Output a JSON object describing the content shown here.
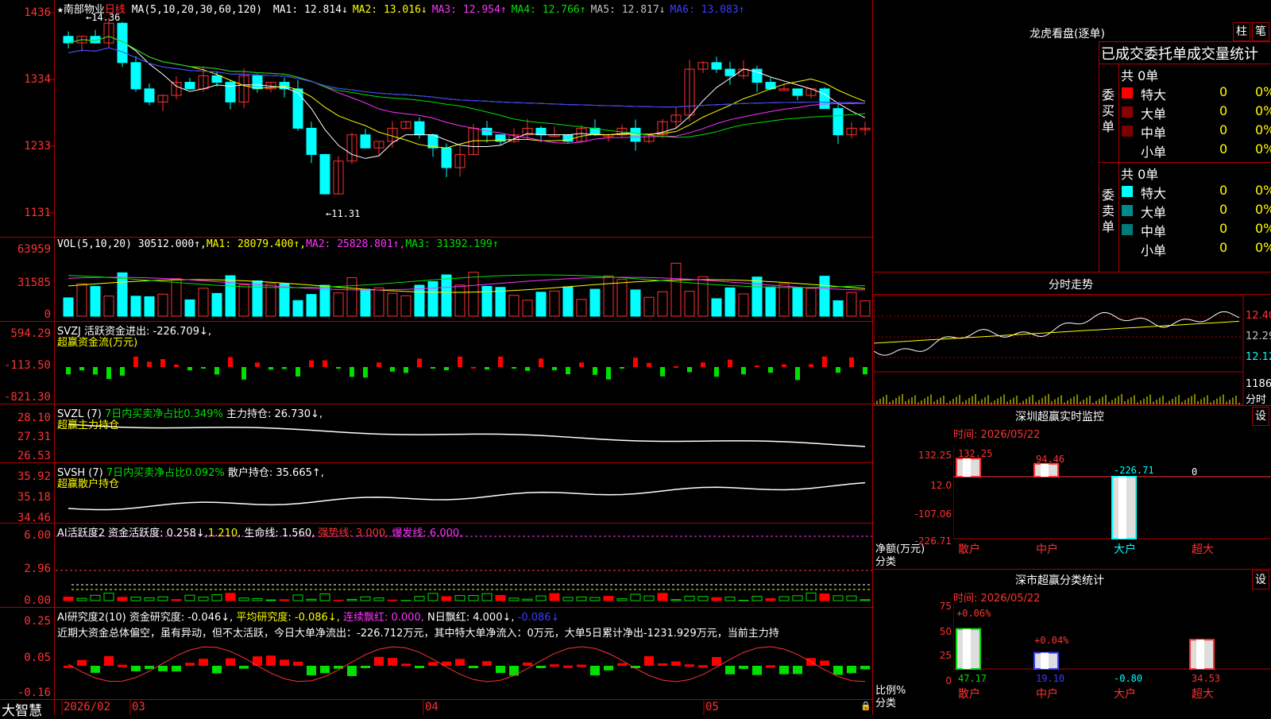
{
  "stock": {
    "name": "南部物业",
    "period": "日线",
    "star": "★"
  },
  "main": {
    "ma_params": "MA(5,10,20,30,60,120)",
    "ma_values": [
      {
        "label": "MA1: 12.814↓",
        "color": "#ffffff"
      },
      {
        "label": "MA2: 13.016↓",
        "color": "#ffff00"
      },
      {
        "label": "MA3: 12.954↑",
        "color": "#ff32ff"
      },
      {
        "label": "MA4: 12.766↑",
        "color": "#00e000"
      },
      {
        "label": "MA5: 12.817↓",
        "color": "#c0c0c0"
      },
      {
        "label": "MA6: 13.083↑",
        "color": "#3c3cff"
      }
    ],
    "axis": [
      "1436",
      "1334",
      "1233",
      "1131"
    ],
    "high_label": "←14.36",
    "low_label": "←11.31"
  },
  "vol": {
    "header": "VOL(5,10,20)",
    "v": "30512.000↑,",
    "ma1": "MA1: 28079.400↑,",
    "ma2": "MA2: 25828.801↑,",
    "ma3": "MA3: 31392.199↑",
    "axis": [
      "63959",
      "31585",
      "0"
    ]
  },
  "svzj": {
    "header": "SVZJ  活跃资金进出: -226.709↓,",
    "sub": "超赢资金流(万元)",
    "axis": [
      "594.29",
      "-113.50",
      "-821.30"
    ]
  },
  "svzl": {
    "header_a": "SVZL (7)",
    "header_b": "7日内买卖净占比0.349%",
    "header_c": "主力持仓: 26.730↓,",
    "sub": "超赢主力持仓",
    "axis": [
      "28.10",
      "27.31",
      "26.53"
    ]
  },
  "svsh": {
    "header_a": "SVSH (7)",
    "header_b": "7日内买卖净占比0.092%",
    "header_c": "散户持仓: 35.665↑,",
    "sub": "超赢散户持仓",
    "axis": [
      "35.92",
      "35.18",
      "34.46"
    ]
  },
  "ai1": {
    "a": "AI活跃度2 资金活跃度: 0.258↓,",
    "b": "1.210,",
    "c": "生命线: 1.560,",
    "d": "强势线: 3.000,",
    "e": "爆发线: 6.000,",
    "axis": [
      "6.00",
      "2.96",
      "0.00"
    ]
  },
  "ai2": {
    "a": "AI研究度2(10) 资金研究度: -0.046↓,",
    "b": "平均研究度: -0.086↓,",
    "c": "连续飘红: 0.000,",
    "d": "N日飘红: 4.000↓,",
    "e": "-0.086↓",
    "comment": "近期大资金总体偏空，虽有异动，但不太活跃，今日大单净流出：-226.712万元，其中特大单净流入：0万元，大单5日累计净出-1231.929万元，当前主力持",
    "axis": [
      "0.25",
      "0.05",
      "-0.16"
    ]
  },
  "bottom": {
    "brand": "大智慧",
    "dates": [
      "2026/02",
      "03",
      "04",
      "05"
    ]
  },
  "right": {
    "title": "龙虎看盘(逐单)",
    "btn_zhu": "柱",
    "btn_bi": "笔",
    "tabs": "已成交委托单成交量统计",
    "buy_label": "委买单",
    "sell_label": "委卖单",
    "buy_total": "共 0单",
    "sell_total": "共 0单",
    "buy_rows": [
      {
        "name": "特大",
        "val": "0",
        "pct": "0%",
        "color": "#ff0000"
      },
      {
        "name": "大单",
        "val": "0",
        "pct": "0%",
        "color": "#8b0000"
      },
      {
        "name": "中单",
        "val": "0",
        "pct": "0%",
        "color": "#7a0000"
      },
      {
        "name": "小单",
        "val": "0",
        "pct": "0%",
        "color": "#000000"
      }
    ],
    "sell_rows": [
      {
        "name": "特大",
        "val": "0",
        "pct": "0%",
        "color": "#00ffff"
      },
      {
        "name": "大单",
        "val": "0",
        "pct": "0%",
        "color": "#008b8b"
      },
      {
        "name": "中单",
        "val": "0",
        "pct": "0%",
        "color": "#007a7a"
      },
      {
        "name": "小单",
        "val": "0",
        "pct": "0%",
        "color": "#000000"
      }
    ],
    "intraday_title": "分时走势",
    "intraday_axis": [
      "12.40",
      "12.29",
      "12.12",
      "1186"
    ],
    "intraday_unit": "分时",
    "sz_title": "深圳超赢实时监控",
    "sz_btn": "设",
    "sz_time": "时间: 2026/05/22",
    "sz_axis": [
      "132.25",
      "12.0",
      "-107.06",
      "-226.71"
    ],
    "sz_unit_a": "净额(万元)",
    "sz_unit_b": "分类",
    "sz_bars": [
      {
        "label": "132.25",
        "value": 132.25
      },
      {
        "label": "94.46",
        "value": 94.46
      },
      {
        "label": "-226.71",
        "value": -226.71
      },
      {
        "label": "0",
        "value": 0
      }
    ],
    "categories": [
      "散户",
      "中户",
      "大户",
      "超大"
    ],
    "cls_title": "深市超赢分类统计",
    "cls_btn": "设",
    "cls_time": "时间: 2026/05/22",
    "cls_axis": [
      "75",
      "50",
      "25",
      "0"
    ],
    "cls_unit_a": "比例%",
    "cls_unit_b": "分类",
    "cls_top": [
      "+0.06%",
      "+0.04%"
    ],
    "cls_values": [
      {
        "label": "47.17",
        "value": 47.17
      },
      {
        "label": "19.10",
        "value": 19.1
      },
      {
        "label": "-0.80",
        "value": -0.8
      },
      {
        "label": "34.53",
        "value": 34.53
      }
    ]
  }
}
